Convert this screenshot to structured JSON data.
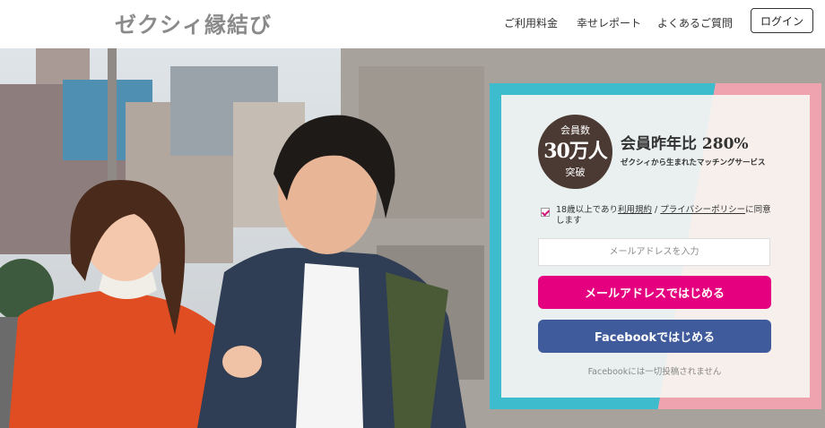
{
  "header": {
    "logo": "ゼクシィ縁結び",
    "nav": [
      "ご利用料金",
      "幸せレポート",
      "よくあるご質問"
    ],
    "login_label": "ログイン"
  },
  "badge": {
    "line1": "会員数",
    "line2": "30万人",
    "line3": "突破"
  },
  "headline": "会員昨年比 280%",
  "subhead": "ゼクシィから生まれたマッチングサービス",
  "agreement": {
    "checked": true,
    "prefix": "18歳以上であり",
    "terms_link": "利用規約",
    "separator": " / ",
    "privacy_link": "プライバシーポリシー",
    "suffix": "に同意します"
  },
  "email_field": {
    "placeholder": "メールアドレスを入力",
    "value": ""
  },
  "buttons": {
    "email_signup": "メールアドレスではじめる",
    "facebook_signup": "Facebookではじめる"
  },
  "facebook_note": "Facebookには一切投稿されません",
  "colors": {
    "primary_pink": "#e4007f",
    "facebook_blue": "#3f5b9b",
    "frame_teal": "#3dbccd",
    "frame_pink": "#efa3ae",
    "badge_brown": "#4b3a33"
  }
}
